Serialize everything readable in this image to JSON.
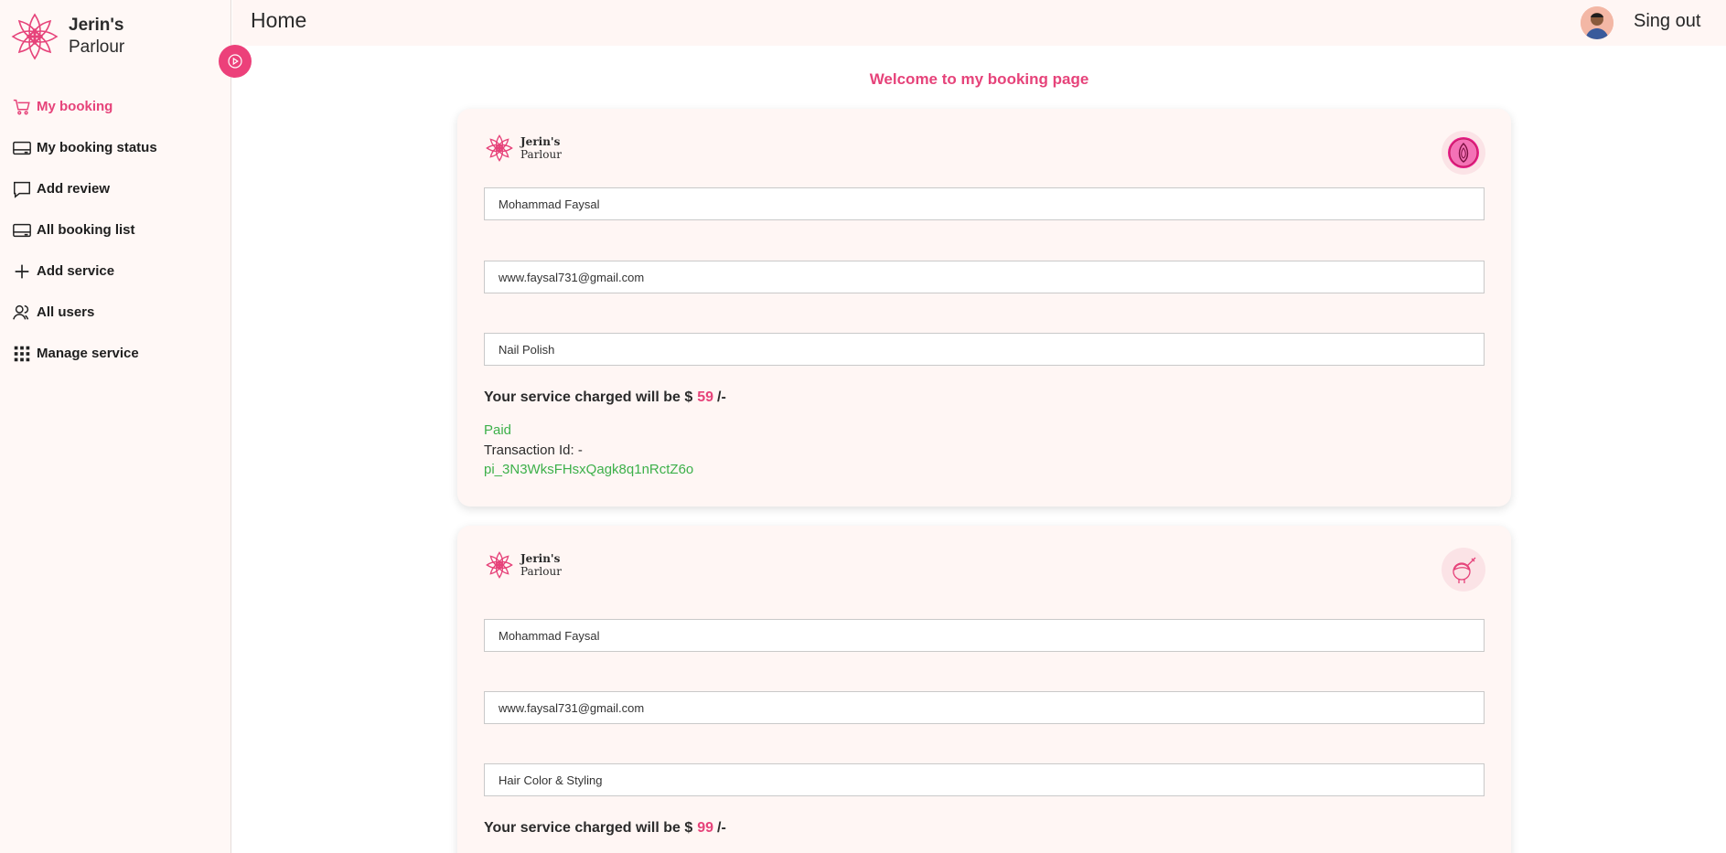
{
  "brand": {
    "line1": "Jerin's",
    "line2": "Parlour"
  },
  "topbar": {
    "title": "Home",
    "signout_label": "Sing out"
  },
  "sidebar": {
    "items": [
      {
        "label": "My booking",
        "icon": "cart-icon",
        "active": true
      },
      {
        "label": "My booking status",
        "icon": "card-icon"
      },
      {
        "label": "Add review",
        "icon": "comment-icon"
      },
      {
        "label": "All booking list",
        "icon": "card-icon"
      },
      {
        "label": "Add service",
        "icon": "plus-icon"
      },
      {
        "label": "All users",
        "icon": "users-icon"
      },
      {
        "label": "Manage service",
        "icon": "grid-icon"
      }
    ]
  },
  "main": {
    "welcome": "Welcome to my booking page",
    "bookings": [
      {
        "name": "Mohammad Faysal",
        "email": "www.faysal731@gmail.com",
        "service": "Nail Polish",
        "charge_prefix": "Your service charged will be $",
        "amount": "59",
        "charge_suffix": "/-",
        "status": "Paid",
        "transaction_label": "Transaction Id: -",
        "transaction_id": "pi_3N3WksFHsxQagk8q1nRctZ6o",
        "service_icon": "nail-icon"
      },
      {
        "name": "Mohammad Faysal",
        "email": "www.faysal731@gmail.com",
        "service": "Hair Color & Styling",
        "charge_prefix": "Your service charged will be $",
        "amount": "99",
        "charge_suffix": "/-",
        "service_icon": "hair-icon"
      }
    ]
  },
  "colors": {
    "accent": "#e6437a",
    "paid": "#3db04a",
    "card_bg": "#fff6f4",
    "sidebar_bg": "#fff8f6"
  }
}
